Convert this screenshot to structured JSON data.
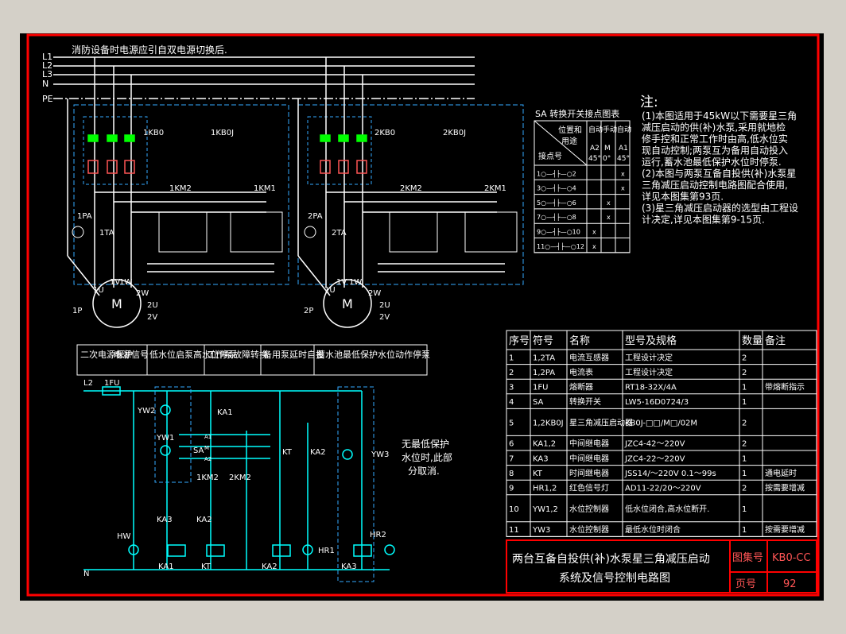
{
  "colors": {
    "background": "#000000",
    "frame": "#ff0000",
    "wire": "#ffffff",
    "text": "#ffffff",
    "cyan": "#00ffff",
    "dashed": "#33aaff",
    "green": "#00ff00",
    "yellow": "#ffff00",
    "pink": "#ff5555"
  },
  "top_note": "消防设备时电源应引自双电源切换后.",
  "bus_labels": [
    "L1",
    "L2",
    "L3",
    "N",
    "PE"
  ],
  "pump1": {
    "breaker": "1KB0",
    "starter": "1KB0J",
    "km2": "1KM2",
    "km1": "1KM1",
    "pa": "1PA",
    "ta": "1TA",
    "phase_u": "1U",
    "phase_v": "1V",
    "phase_w": "1W",
    "out_w": "2W",
    "out_u": "2U",
    "out_v": "2V",
    "motor": "M",
    "p": "1P"
  },
  "pump2": {
    "breaker": "2KB0",
    "starter": "2KB0J",
    "km2": "2KM2",
    "km1": "2KM1",
    "pa": "2PA",
    "ta": "2TA",
    "phase_u": "1U",
    "phase_v": "1V",
    "phase_w": "1W",
    "out_w": "2W",
    "out_u": "2U",
    "out_v": "2V",
    "motor": "M",
    "p": "2P"
  },
  "sa_table": {
    "title": "SA 转换开关接点图表",
    "hdr_position": "位置和",
    "hdr_use": "用途",
    "hdr_contact": "接点号",
    "cols": [
      {
        "top": "自动",
        "mid": "A2",
        "bot": "45°"
      },
      {
        "top": "手动",
        "mid": "M",
        "bot": "0°"
      },
      {
        "top": "自动",
        "mid": "A1",
        "bot": "45°"
      }
    ],
    "rows": [
      {
        "label": "1○—┤├—○2",
        "marks": [
          "",
          "",
          "x"
        ]
      },
      {
        "label": "3○—┤├—○4",
        "marks": [
          "",
          "",
          "x"
        ]
      },
      {
        "label": "5○—┤├—○6",
        "marks": [
          "",
          "x",
          ""
        ]
      },
      {
        "label": "7○—┤├—○8",
        "marks": [
          "",
          "x",
          ""
        ]
      },
      {
        "label": "9○—┤├—○10",
        "marks": [
          "x",
          "",
          ""
        ]
      },
      {
        "label": "11○—┤├—○12",
        "marks": [
          "x",
          "",
          ""
        ]
      }
    ]
  },
  "notes": {
    "title": "注:",
    "lines": [
      "(1)本图适用于45kW以下需要星三角",
      "   减压启动的供(补)水泵,采用就地检",
      "   修手控和正常工作时由高,低水位实",
      "   现自动控制;两泵互为备用自动投入",
      "   运行,蓄水池最低保护水位时停泵.",
      "(2)本图与两泵互备自投供(补)水泵星",
      "   三角减压启动控制电路图配合使用,",
      "   详见本图集第93页.",
      "(3)星三角减压启动器的选型由工程设",
      "   计决定,详见本图集第9-15页."
    ]
  },
  "parts_table": {
    "headers": [
      "序号",
      "符号",
      "名称",
      "型号及规格",
      "数量",
      "备注"
    ],
    "rows": [
      [
        "1",
        "1,2TA",
        "电流互感器",
        "工程设计决定",
        "2",
        ""
      ],
      [
        "2",
        "1,2PA",
        "电流表",
        "工程设计决定",
        "2",
        ""
      ],
      [
        "3",
        "1FU",
        "熔断器",
        "RT18-32X/4A",
        "1",
        "带熔断指示"
      ],
      [
        "4",
        "SA",
        "转换开关",
        "LW5-16D0724/3",
        "1",
        ""
      ],
      [
        "5",
        "1,2KB0J",
        "星三角减压启动器",
        "KB0J-□□/M□/02M",
        "2",
        ""
      ],
      [
        "6",
        "KA1,2",
        "中间继电器",
        "JZC4-42～220V",
        "2",
        ""
      ],
      [
        "7",
        "KA3",
        "中间继电器",
        "JZC4-22～220V",
        "1",
        ""
      ],
      [
        "8",
        "KT",
        "时间继电器",
        "JSS14/～220V 0.1～99s",
        "1",
        "通电延时"
      ],
      [
        "9",
        "HR1,2",
        "红色信号灯",
        "AD11-22/20～220V",
        "2",
        "按需要增减"
      ],
      [
        "10",
        "YW1,2",
        "水位控制器",
        "低水位闭合,高水位断开.",
        "1",
        ""
      ],
      [
        "11",
        "YW3",
        "水位控制器",
        "最低水位时闭合",
        "1",
        "按需要增减"
      ]
    ]
  },
  "title_block": {
    "title_line1": "两台互备自投供(补)水泵星三角减压启动",
    "title_line2": "系统及信号控制电路图",
    "atlas_label": "图集号",
    "atlas_value": "KB0-CC",
    "page_label": "页号",
    "page_value": "92"
  },
  "control": {
    "func_headers": [
      "二次电源保护",
      "电源信号",
      "低水位启泵高水位停泵",
      "工作泵故障转换",
      "备用泵延时自投",
      "蓄水池最低保护水位动作停泵"
    ],
    "l2": "L2",
    "fu": "1FU",
    "n": "N",
    "yw2": "YW2",
    "yw1": "YW1",
    "yw3": "YW3",
    "sa": "SA",
    "sa_a1": "A1",
    "sa_m": "M",
    "sa_a2": "A2",
    "ka1_top": "KA1",
    "kt_top": "KT",
    "ka2_top": "KA2",
    "km_1": "1KM2",
    "km_2": "2KM2",
    "ka3_contact": "KA3",
    "ka2_contact": "KA2",
    "hw": "HW",
    "hr1": "HR1",
    "hr2": "HR2",
    "coil_ka1": "KA1",
    "coil_kt": "KT",
    "coil_ka2": "KA2",
    "coil_ka3": "KA3",
    "side_note_1": "无最低保护",
    "side_note_2": "水位时,此部",
    "side_note_3": "分取消."
  }
}
